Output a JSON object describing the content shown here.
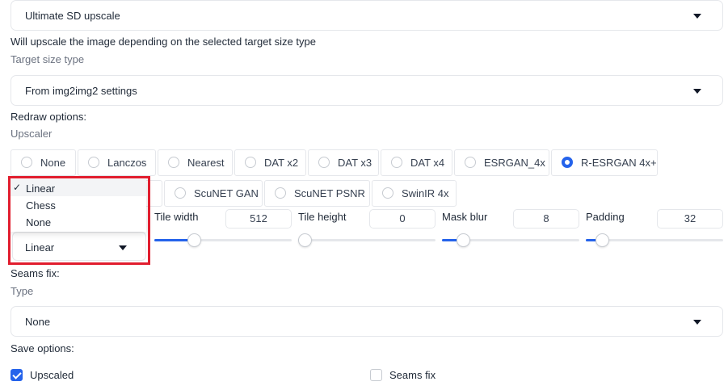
{
  "script_select": {
    "value": "Ultimate SD upscale"
  },
  "description": "Will upscale the image depending on the selected target size type",
  "target_size": {
    "label": "Target size type",
    "value": "From img2img2 settings"
  },
  "redraw_options_label": "Redraw options:",
  "upscaler": {
    "label": "Upscaler",
    "options": [
      "None",
      "Lanczos",
      "Nearest",
      "DAT x2",
      "DAT x3",
      "DAT x4",
      "ESRGAN_4x",
      "R-ESRGAN 4x+",
      "ScuNET GAN",
      "ScuNET PSNR",
      "SwinIR 4x"
    ],
    "selected": "R-ESRGAN 4x+"
  },
  "redraw_type": {
    "value": "Linear",
    "options": [
      "Linear",
      "Chess",
      "None"
    ],
    "selected_marker": "✓"
  },
  "tile_width": {
    "label": "Tile width",
    "value": "512",
    "fraction": 0.27
  },
  "tile_height": {
    "label": "Tile height",
    "value": "0",
    "fraction": 0.0
  },
  "mask_blur": {
    "label": "Mask blur",
    "value": "8",
    "fraction": 0.12
  },
  "padding": {
    "label": "Padding",
    "value": "32",
    "fraction": 0.08
  },
  "seams_fix": {
    "label": "Seams fix:",
    "type_label": "Type",
    "value": "None"
  },
  "save_options": {
    "label": "Save options:",
    "upscaled": {
      "label": "Upscaled",
      "checked": true
    },
    "seams_fix": {
      "label": "Seams fix",
      "checked": false
    }
  },
  "colors": {
    "accent": "#2563eb",
    "highlight": "#e11d2e",
    "border": "#e5e7eb",
    "muted_text": "#6b7280"
  }
}
